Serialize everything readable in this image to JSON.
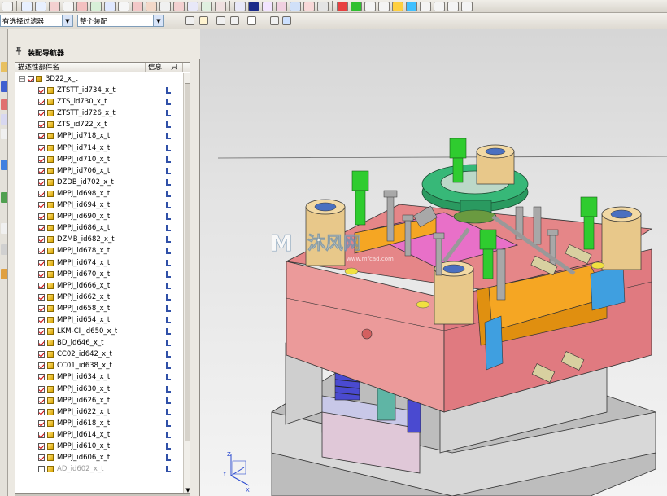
{
  "toolbar2": {
    "filter_value": "有选择过滤器",
    "scope_value": "整个装配"
  },
  "navigator": {
    "title": "装配导航器",
    "columns": {
      "name": "描述性部件名",
      "info": "信息",
      "extra": "只"
    },
    "root": "3D22_x_t",
    "items": [
      {
        "label": "ZTSTT_id734_x_t",
        "checked": true
      },
      {
        "label": "ZTS_id730_x_t",
        "checked": true
      },
      {
        "label": "ZTSTT_id726_x_t",
        "checked": true
      },
      {
        "label": "ZTS_id722_x_t",
        "checked": true
      },
      {
        "label": "MPPJ_id718_x_t",
        "checked": true
      },
      {
        "label": "MPPJ_id714_x_t",
        "checked": true
      },
      {
        "label": "MPPJ_id710_x_t",
        "checked": true
      },
      {
        "label": "MPPJ_id706_x_t",
        "checked": true
      },
      {
        "label": "DZDB_id702_x_t",
        "checked": true
      },
      {
        "label": "MPPJ_id698_x_t",
        "checked": true
      },
      {
        "label": "MPPJ_id694_x_t",
        "checked": true
      },
      {
        "label": "MPPJ_id690_x_t",
        "checked": true
      },
      {
        "label": "MPPJ_id686_x_t",
        "checked": true
      },
      {
        "label": "DZMB_id682_x_t",
        "checked": true
      },
      {
        "label": "MPPJ_id678_x_t",
        "checked": true
      },
      {
        "label": "MPPJ_id674_x_t",
        "checked": true
      },
      {
        "label": "MPPJ_id670_x_t",
        "checked": true
      },
      {
        "label": "MPPJ_id666_x_t",
        "checked": true
      },
      {
        "label": "MPPJ_id662_x_t",
        "checked": true
      },
      {
        "label": "MPPJ_id658_x_t",
        "checked": true
      },
      {
        "label": "MPPJ_id654_x_t",
        "checked": true
      },
      {
        "label": "LKM-CI_id650_x_t",
        "checked": true
      },
      {
        "label": "BD_id646_x_t",
        "checked": true
      },
      {
        "label": "CC02_id642_x_t",
        "checked": true
      },
      {
        "label": "CC01_id638_x_t",
        "checked": true
      },
      {
        "label": "MPPJ_id634_x_t",
        "checked": true
      },
      {
        "label": "MPPJ_id630_x_t",
        "checked": true
      },
      {
        "label": "MPPJ_id626_x_t",
        "checked": true
      },
      {
        "label": "MPPJ_id622_x_t",
        "checked": true
      },
      {
        "label": "MPPJ_id618_x_t",
        "checked": true
      },
      {
        "label": "MPPJ_id614_x_t",
        "checked": true
      },
      {
        "label": "MPPJ_id610_x_t",
        "checked": true
      },
      {
        "label": "MPPJ_id606_x_t",
        "checked": true
      },
      {
        "label": "AD_id602_x_t",
        "checked": false
      }
    ]
  },
  "viewport": {
    "watermark": "沐风网",
    "watermark_url": "www.mfcad.com",
    "axis_z": "Z",
    "axis_y": "Y",
    "axis_x": "X"
  },
  "colors": {
    "plate_pink": "#e9868a",
    "plate_gray": "#c9c9c9",
    "slider_orange": "#f5a623",
    "bushing_tan": "#e8c88a",
    "pin_green": "#2fcc2f",
    "ring_green": "#2aa86a",
    "spring_blue": "#4a4ad0"
  }
}
